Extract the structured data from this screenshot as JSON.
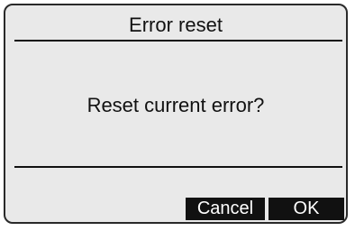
{
  "dialog": {
    "title": "Error reset",
    "message": "Reset current error?"
  },
  "buttons": {
    "cancel_label": "Cancel",
    "ok_label": "OK"
  }
}
